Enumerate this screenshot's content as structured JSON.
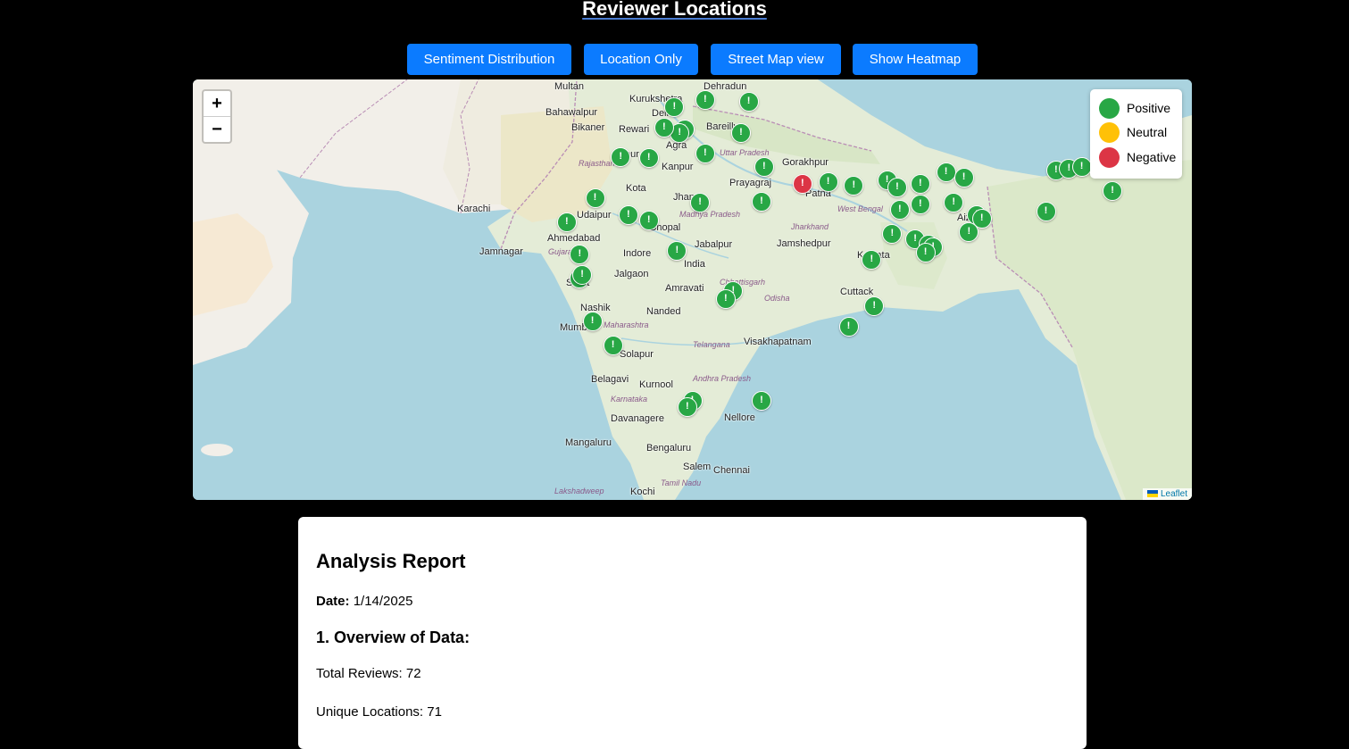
{
  "title": "Reviewer Locations",
  "toolbar": {
    "buttons": [
      "Sentiment Distribution",
      "Location Only",
      "Street Map view",
      "Show Heatmap"
    ]
  },
  "map": {
    "zoom_in": "+",
    "zoom_out": "−",
    "attribution": "Leaflet",
    "marker_symbol": "!",
    "legend": [
      {
        "label": "Positive",
        "color": "#28a745"
      },
      {
        "label": "Neutral",
        "color": "#ffc107"
      },
      {
        "label": "Negative",
        "color": "#dc3545"
      }
    ],
    "cities": [
      "Dehradun",
      "Kurukshetra",
      "Delhi",
      "Bikaner",
      "Rewari",
      "Bareilly",
      "Agra",
      "Kanpur",
      "Jaipur",
      "Gorakhpur",
      "Prayagraj",
      "Patna",
      "Kota",
      "Jhansi",
      "Udaipur",
      "Bhopal",
      "Ahmedabad",
      "Jamnagar",
      "Indore",
      "Jabalpur",
      "Jamshedpur",
      "Kolkata",
      "Jalgaon",
      "India",
      "Surat",
      "Amravati",
      "Cuttack",
      "Nashik",
      "Nanded",
      "Mumbai",
      "Visakhapatnam",
      "Solapur",
      "Belagavi",
      "Kurnool",
      "Davanagere",
      "Nellore",
      "Mangaluru",
      "Bengaluru",
      "Chennai",
      "Salem",
      "Kochi",
      "Aizawl",
      "Multan",
      "Bahawalpur",
      "Karachi"
    ],
    "regions": [
      "Rajasthan",
      "Gujarat",
      "Madhya Pradesh",
      "Uttar Pradesh",
      "Chhattisgarh",
      "Odisha",
      "Maharashtra",
      "Telangana",
      "Andhra Pradesh",
      "Karnataka",
      "Tamil Nadu",
      "Jharkhand",
      "West Bengal",
      "Lakshadweep"
    ],
    "markers": [
      {
        "lat": 30.3,
        "lon": 78.0,
        "sentiment": "positive"
      },
      {
        "lat": 29.9,
        "lon": 76.8,
        "sentiment": "positive"
      },
      {
        "lat": 28.6,
        "lon": 77.2,
        "sentiment": "positive"
      },
      {
        "lat": 28.4,
        "lon": 77.0,
        "sentiment": "positive"
      },
      {
        "lat": 28.7,
        "lon": 76.4,
        "sentiment": "positive"
      },
      {
        "lat": 28.4,
        "lon": 79.4,
        "sentiment": "positive"
      },
      {
        "lat": 30.2,
        "lon": 79.7,
        "sentiment": "positive"
      },
      {
        "lat": 27.2,
        "lon": 78.0,
        "sentiment": "positive"
      },
      {
        "lat": 26.9,
        "lon": 75.8,
        "sentiment": "positive"
      },
      {
        "lat": 27.0,
        "lon": 74.7,
        "sentiment": "positive"
      },
      {
        "lat": 26.4,
        "lon": 80.3,
        "sentiment": "positive"
      },
      {
        "lat": 25.4,
        "lon": 81.8,
        "sentiment": "negative"
      },
      {
        "lat": 25.5,
        "lon": 82.8,
        "sentiment": "positive"
      },
      {
        "lat": 25.3,
        "lon": 83.8,
        "sentiment": "positive"
      },
      {
        "lat": 25.6,
        "lon": 85.1,
        "sentiment": "positive"
      },
      {
        "lat": 25.2,
        "lon": 85.5,
        "sentiment": "positive"
      },
      {
        "lat": 25.4,
        "lon": 86.4,
        "sentiment": "positive"
      },
      {
        "lat": 26.1,
        "lon": 87.4,
        "sentiment": "positive"
      },
      {
        "lat": 25.8,
        "lon": 88.1,
        "sentiment": "positive"
      },
      {
        "lat": 26.2,
        "lon": 91.7,
        "sentiment": "positive"
      },
      {
        "lat": 26.3,
        "lon": 92.2,
        "sentiment": "positive"
      },
      {
        "lat": 26.4,
        "lon": 92.7,
        "sentiment": "positive"
      },
      {
        "lat": 25.0,
        "lon": 93.9,
        "sentiment": "positive"
      },
      {
        "lat": 23.8,
        "lon": 91.3,
        "sentiment": "positive"
      },
      {
        "lat": 27.5,
        "lon": 95.3,
        "sentiment": "positive"
      },
      {
        "lat": 24.6,
        "lon": 73.7,
        "sentiment": "positive"
      },
      {
        "lat": 23.2,
        "lon": 72.6,
        "sentiment": "positive"
      },
      {
        "lat": 23.6,
        "lon": 75.0,
        "sentiment": "positive"
      },
      {
        "lat": 23.3,
        "lon": 75.8,
        "sentiment": "positive"
      },
      {
        "lat": 24.3,
        "lon": 77.8,
        "sentiment": "positive"
      },
      {
        "lat": 24.4,
        "lon": 80.2,
        "sentiment": "positive"
      },
      {
        "lat": 23.9,
        "lon": 85.6,
        "sentiment": "positive"
      },
      {
        "lat": 24.2,
        "lon": 86.4,
        "sentiment": "positive"
      },
      {
        "lat": 24.3,
        "lon": 87.7,
        "sentiment": "positive"
      },
      {
        "lat": 23.6,
        "lon": 88.6,
        "sentiment": "positive"
      },
      {
        "lat": 23.4,
        "lon": 88.8,
        "sentiment": "positive"
      },
      {
        "lat": 22.6,
        "lon": 88.3,
        "sentiment": "positive"
      },
      {
        "lat": 22.5,
        "lon": 85.3,
        "sentiment": "positive"
      },
      {
        "lat": 22.2,
        "lon": 86.2,
        "sentiment": "positive"
      },
      {
        "lat": 21.9,
        "lon": 86.7,
        "sentiment": "positive"
      },
      {
        "lat": 21.7,
        "lon": 86.9,
        "sentiment": "positive"
      },
      {
        "lat": 21.4,
        "lon": 86.6,
        "sentiment": "positive"
      },
      {
        "lat": 21.0,
        "lon": 84.5,
        "sentiment": "positive"
      },
      {
        "lat": 21.3,
        "lon": 73.1,
        "sentiment": "positive"
      },
      {
        "lat": 21.5,
        "lon": 76.9,
        "sentiment": "positive"
      },
      {
        "lat": 19.9,
        "lon": 73.1,
        "sentiment": "positive"
      },
      {
        "lat": 20.1,
        "lon": 73.2,
        "sentiment": "positive"
      },
      {
        "lat": 19.2,
        "lon": 79.1,
        "sentiment": "positive"
      },
      {
        "lat": 18.7,
        "lon": 78.8,
        "sentiment": "positive"
      },
      {
        "lat": 18.3,
        "lon": 84.6,
        "sentiment": "positive"
      },
      {
        "lat": 17.1,
        "lon": 83.6,
        "sentiment": "positive"
      },
      {
        "lat": 17.4,
        "lon": 73.6,
        "sentiment": "positive"
      },
      {
        "lat": 16.0,
        "lon": 74.4,
        "sentiment": "positive"
      },
      {
        "lat": 12.8,
        "lon": 77.5,
        "sentiment": "positive"
      },
      {
        "lat": 12.4,
        "lon": 77.3,
        "sentiment": "positive"
      },
      {
        "lat": 12.8,
        "lon": 80.2,
        "sentiment": "positive"
      }
    ]
  },
  "report": {
    "title": "Analysis Report",
    "date_label": "Date:",
    "date_value": "1/14/2025",
    "section1": "1. Overview of Data:",
    "total_reviews": "Total Reviews: 72",
    "unique_locations": "Unique Locations: 71"
  }
}
